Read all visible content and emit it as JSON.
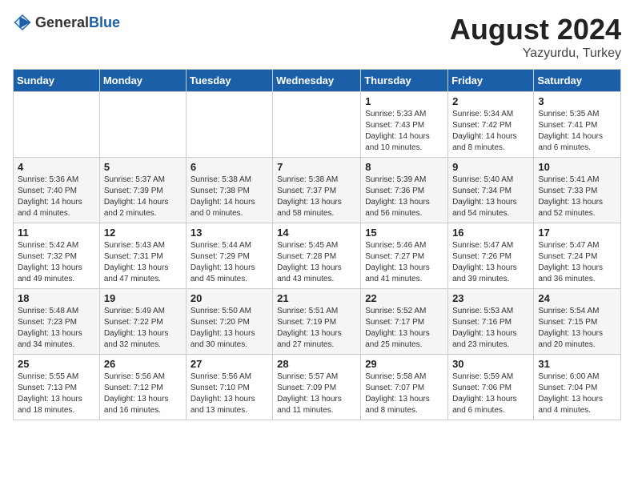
{
  "header": {
    "logo_general": "General",
    "logo_blue": "Blue",
    "month_year": "August 2024",
    "location": "Yazyurdu, Turkey"
  },
  "days_of_week": [
    "Sunday",
    "Monday",
    "Tuesday",
    "Wednesday",
    "Thursday",
    "Friday",
    "Saturday"
  ],
  "weeks": [
    [
      {
        "day": "",
        "info": ""
      },
      {
        "day": "",
        "info": ""
      },
      {
        "day": "",
        "info": ""
      },
      {
        "day": "",
        "info": ""
      },
      {
        "day": "1",
        "info": "Sunrise: 5:33 AM\nSunset: 7:43 PM\nDaylight: 14 hours\nand 10 minutes."
      },
      {
        "day": "2",
        "info": "Sunrise: 5:34 AM\nSunset: 7:42 PM\nDaylight: 14 hours\nand 8 minutes."
      },
      {
        "day": "3",
        "info": "Sunrise: 5:35 AM\nSunset: 7:41 PM\nDaylight: 14 hours\nand 6 minutes."
      }
    ],
    [
      {
        "day": "4",
        "info": "Sunrise: 5:36 AM\nSunset: 7:40 PM\nDaylight: 14 hours\nand 4 minutes."
      },
      {
        "day": "5",
        "info": "Sunrise: 5:37 AM\nSunset: 7:39 PM\nDaylight: 14 hours\nand 2 minutes."
      },
      {
        "day": "6",
        "info": "Sunrise: 5:38 AM\nSunset: 7:38 PM\nDaylight: 14 hours\nand 0 minutes."
      },
      {
        "day": "7",
        "info": "Sunrise: 5:38 AM\nSunset: 7:37 PM\nDaylight: 13 hours\nand 58 minutes."
      },
      {
        "day": "8",
        "info": "Sunrise: 5:39 AM\nSunset: 7:36 PM\nDaylight: 13 hours\nand 56 minutes."
      },
      {
        "day": "9",
        "info": "Sunrise: 5:40 AM\nSunset: 7:34 PM\nDaylight: 13 hours\nand 54 minutes."
      },
      {
        "day": "10",
        "info": "Sunrise: 5:41 AM\nSunset: 7:33 PM\nDaylight: 13 hours\nand 52 minutes."
      }
    ],
    [
      {
        "day": "11",
        "info": "Sunrise: 5:42 AM\nSunset: 7:32 PM\nDaylight: 13 hours\nand 49 minutes."
      },
      {
        "day": "12",
        "info": "Sunrise: 5:43 AM\nSunset: 7:31 PM\nDaylight: 13 hours\nand 47 minutes."
      },
      {
        "day": "13",
        "info": "Sunrise: 5:44 AM\nSunset: 7:29 PM\nDaylight: 13 hours\nand 45 minutes."
      },
      {
        "day": "14",
        "info": "Sunrise: 5:45 AM\nSunset: 7:28 PM\nDaylight: 13 hours\nand 43 minutes."
      },
      {
        "day": "15",
        "info": "Sunrise: 5:46 AM\nSunset: 7:27 PM\nDaylight: 13 hours\nand 41 minutes."
      },
      {
        "day": "16",
        "info": "Sunrise: 5:47 AM\nSunset: 7:26 PM\nDaylight: 13 hours\nand 39 minutes."
      },
      {
        "day": "17",
        "info": "Sunrise: 5:47 AM\nSunset: 7:24 PM\nDaylight: 13 hours\nand 36 minutes."
      }
    ],
    [
      {
        "day": "18",
        "info": "Sunrise: 5:48 AM\nSunset: 7:23 PM\nDaylight: 13 hours\nand 34 minutes."
      },
      {
        "day": "19",
        "info": "Sunrise: 5:49 AM\nSunset: 7:22 PM\nDaylight: 13 hours\nand 32 minutes."
      },
      {
        "day": "20",
        "info": "Sunrise: 5:50 AM\nSunset: 7:20 PM\nDaylight: 13 hours\nand 30 minutes."
      },
      {
        "day": "21",
        "info": "Sunrise: 5:51 AM\nSunset: 7:19 PM\nDaylight: 13 hours\nand 27 minutes."
      },
      {
        "day": "22",
        "info": "Sunrise: 5:52 AM\nSunset: 7:17 PM\nDaylight: 13 hours\nand 25 minutes."
      },
      {
        "day": "23",
        "info": "Sunrise: 5:53 AM\nSunset: 7:16 PM\nDaylight: 13 hours\nand 23 minutes."
      },
      {
        "day": "24",
        "info": "Sunrise: 5:54 AM\nSunset: 7:15 PM\nDaylight: 13 hours\nand 20 minutes."
      }
    ],
    [
      {
        "day": "25",
        "info": "Sunrise: 5:55 AM\nSunset: 7:13 PM\nDaylight: 13 hours\nand 18 minutes."
      },
      {
        "day": "26",
        "info": "Sunrise: 5:56 AM\nSunset: 7:12 PM\nDaylight: 13 hours\nand 16 minutes."
      },
      {
        "day": "27",
        "info": "Sunrise: 5:56 AM\nSunset: 7:10 PM\nDaylight: 13 hours\nand 13 minutes."
      },
      {
        "day": "28",
        "info": "Sunrise: 5:57 AM\nSunset: 7:09 PM\nDaylight: 13 hours\nand 11 minutes."
      },
      {
        "day": "29",
        "info": "Sunrise: 5:58 AM\nSunset: 7:07 PM\nDaylight: 13 hours\nand 8 minutes."
      },
      {
        "day": "30",
        "info": "Sunrise: 5:59 AM\nSunset: 7:06 PM\nDaylight: 13 hours\nand 6 minutes."
      },
      {
        "day": "31",
        "info": "Sunrise: 6:00 AM\nSunset: 7:04 PM\nDaylight: 13 hours\nand 4 minutes."
      }
    ]
  ]
}
